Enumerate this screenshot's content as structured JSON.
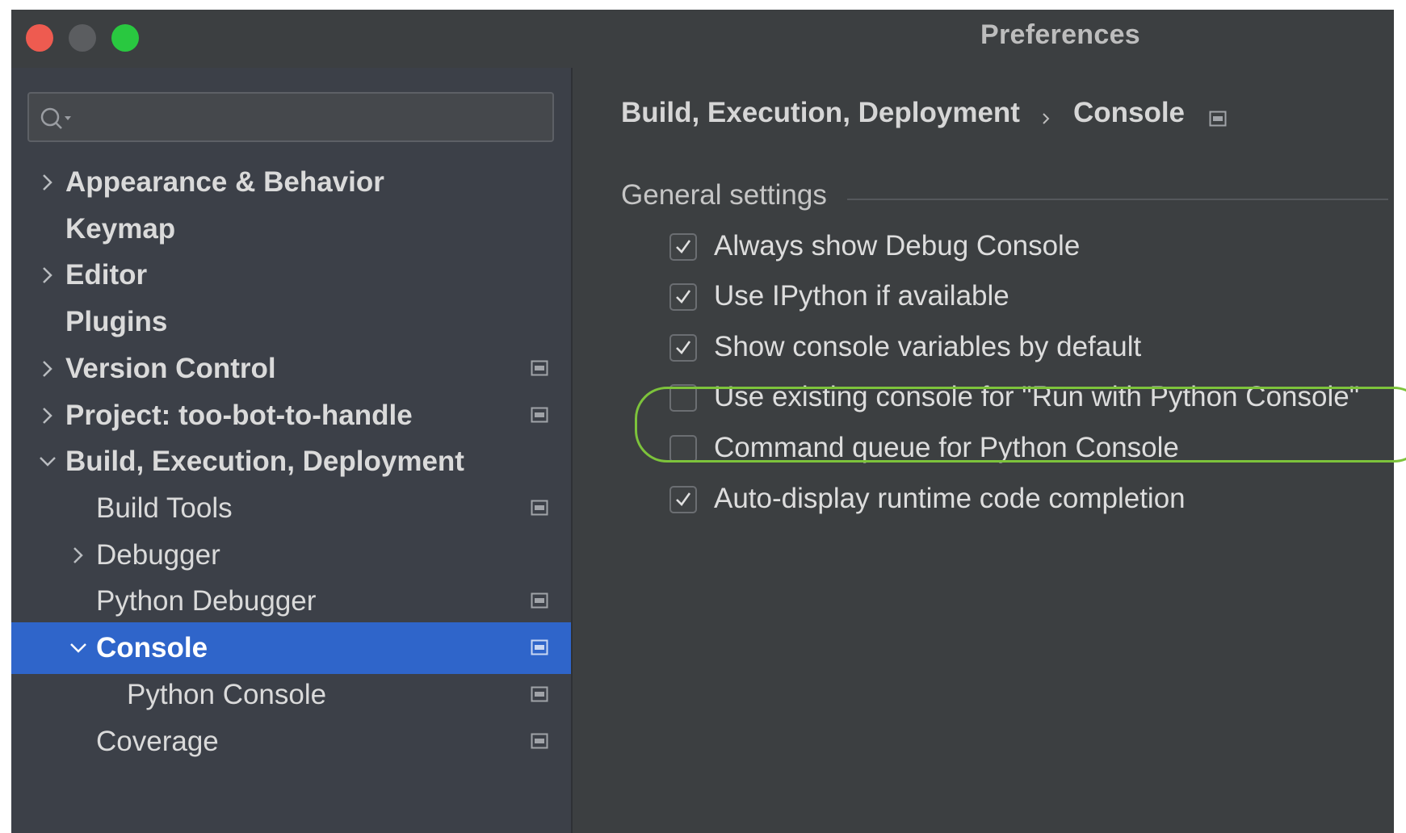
{
  "window": {
    "title": "Preferences"
  },
  "colors": {
    "accent_selection": "#2f65ca",
    "highlight_ring": "#7dc33b",
    "close": "#ee5b50",
    "maximize": "#29c840"
  },
  "search": {
    "placeholder": "",
    "value": "",
    "icon": "search-icon"
  },
  "sidebar": {
    "items": [
      {
        "label": "Appearance & Behavior",
        "expandable": true,
        "expanded": false,
        "bold": true,
        "level": 0,
        "project_icon": false
      },
      {
        "label": "Keymap",
        "expandable": false,
        "bold": true,
        "level": 0,
        "project_icon": false
      },
      {
        "label": "Editor",
        "expandable": true,
        "expanded": false,
        "bold": true,
        "level": 0,
        "project_icon": false
      },
      {
        "label": "Plugins",
        "expandable": false,
        "bold": true,
        "level": 0,
        "project_icon": false
      },
      {
        "label": "Version Control",
        "expandable": true,
        "expanded": false,
        "bold": true,
        "level": 0,
        "project_icon": true
      },
      {
        "label": "Project: too-bot-to-handle",
        "expandable": true,
        "expanded": false,
        "bold": true,
        "level": 0,
        "project_icon": true
      },
      {
        "label": "Build, Execution, Deployment",
        "expandable": true,
        "expanded": true,
        "bold": true,
        "level": 0,
        "project_icon": false
      },
      {
        "label": "Build Tools",
        "expandable": false,
        "bold": false,
        "level": 1,
        "project_icon": true
      },
      {
        "label": "Debugger",
        "expandable": true,
        "expanded": false,
        "bold": false,
        "level": 1,
        "project_icon": false
      },
      {
        "label": "Python Debugger",
        "expandable": false,
        "bold": false,
        "level": 1,
        "project_icon": true
      },
      {
        "label": "Console",
        "expandable": true,
        "expanded": true,
        "bold": false,
        "level": 1,
        "project_icon": true,
        "selected": true
      },
      {
        "label": "Python Console",
        "expandable": false,
        "bold": false,
        "level": 2,
        "project_icon": true
      },
      {
        "label": "Coverage",
        "expandable": false,
        "bold": false,
        "level": 1,
        "project_icon": true
      }
    ]
  },
  "breadcrumb": {
    "parent": "Build, Execution, Deployment",
    "current": "Console"
  },
  "general_settings": {
    "title": "General settings",
    "options": [
      {
        "label": "Always show Debug Console",
        "checked": true
      },
      {
        "label": "Use IPython if available",
        "checked": true
      },
      {
        "label": "Show console variables by default",
        "checked": true
      },
      {
        "label": "Use existing console for \"Run with Python Console\"",
        "checked": false,
        "highlighted": true
      },
      {
        "label": "Command queue for Python Console",
        "checked": false
      },
      {
        "label": "Auto-display runtime code completion",
        "checked": true
      }
    ]
  }
}
